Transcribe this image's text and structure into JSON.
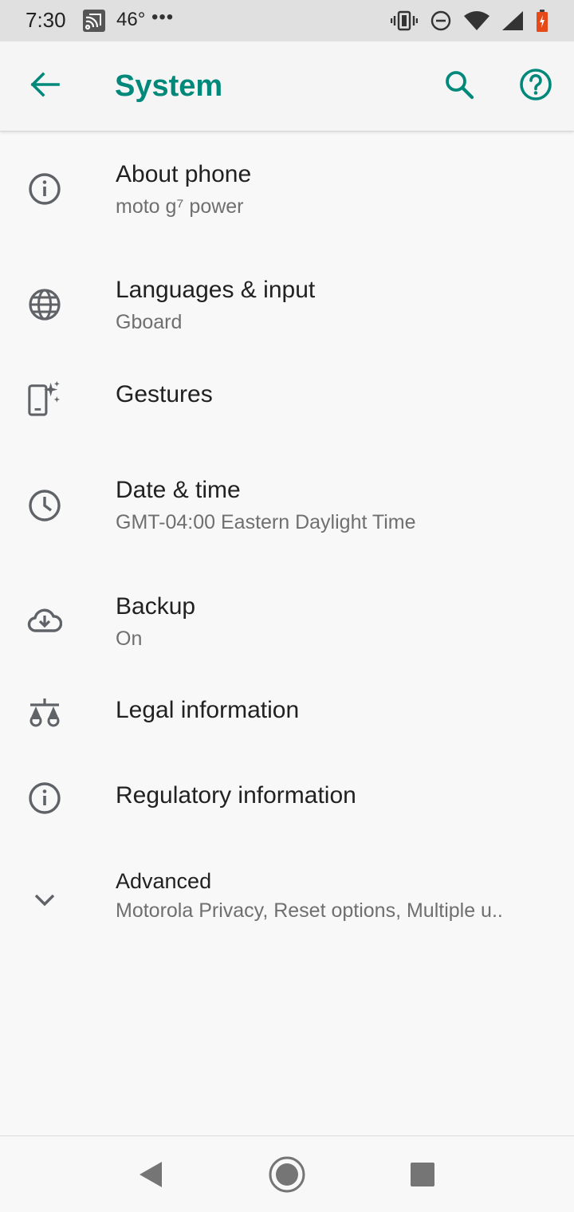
{
  "status_bar": {
    "time": "7:30",
    "temperature": "46°",
    "dots": "•••",
    "icons": [
      "cast-icon",
      "vibrate-icon",
      "dnd-icon",
      "wifi-icon",
      "signal-icon",
      "battery-icon"
    ]
  },
  "app_bar": {
    "title": "System",
    "accent_color": "#00897b",
    "icons": [
      "back-arrow-icon",
      "search-icon",
      "help-icon"
    ]
  },
  "items": [
    {
      "label": "About phone",
      "sub": "moto g⁷ power",
      "icon": "info-icon"
    },
    {
      "label": "Languages & input",
      "sub": "Gboard",
      "icon": "globe-icon"
    },
    {
      "label": "Gestures",
      "sub": "",
      "icon": "gestures-icon"
    },
    {
      "label": "Date & time",
      "sub": "GMT-04:00 Eastern Daylight Time",
      "icon": "clock-icon"
    },
    {
      "label": "Backup",
      "sub": "On",
      "icon": "cloud-backup-icon"
    },
    {
      "label": "Legal information",
      "sub": "",
      "icon": "scales-icon"
    },
    {
      "label": "Regulatory information",
      "sub": "",
      "icon": "info-icon"
    },
    {
      "label": "Advanced",
      "sub": "Motorola Privacy, Reset options, Multiple u..",
      "icon": "chevron-down-icon"
    }
  ],
  "nav_bar": {
    "icons": [
      "nav-back-icon",
      "nav-home-icon",
      "nav-recents-icon"
    ]
  }
}
